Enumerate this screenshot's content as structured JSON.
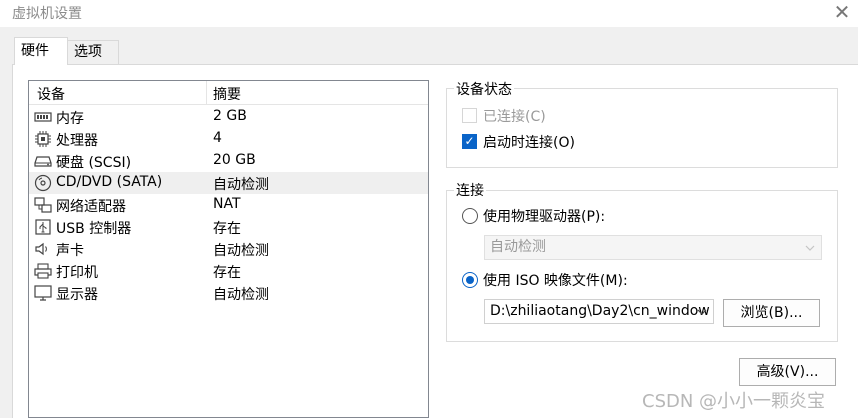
{
  "window": {
    "title": "虚拟机设置",
    "close_glyph": "✕"
  },
  "tabs": [
    {
      "label": "硬件"
    },
    {
      "label": "选项"
    }
  ],
  "device_list": {
    "headers": {
      "device": "设备",
      "summary": "摘要"
    },
    "rows": [
      {
        "name": "内存",
        "summary": "2 GB",
        "icon": "memory-icon"
      },
      {
        "name": "处理器",
        "summary": "4",
        "icon": "cpu-icon"
      },
      {
        "name": "硬盘 (SCSI)",
        "summary": "20 GB",
        "icon": "hard-disk-icon"
      },
      {
        "name": "CD/DVD (SATA)",
        "summary": "自动检测",
        "icon": "cd-dvd-icon"
      },
      {
        "name": "网络适配器",
        "summary": "NAT",
        "icon": "network-adapter-icon"
      },
      {
        "name": "USB 控制器",
        "summary": "存在",
        "icon": "usb-icon"
      },
      {
        "name": "声卡",
        "summary": "自动检测",
        "icon": "speaker-icon"
      },
      {
        "name": "打印机",
        "summary": "存在",
        "icon": "printer-icon"
      },
      {
        "name": "显示器",
        "summary": "自动检测",
        "icon": "monitor-icon"
      }
    ],
    "selected_index": 3
  },
  "device_status": {
    "title": "设备状态",
    "connected_label": "已连接(C)",
    "connect_on_power_on_label": "启动时连接(O)"
  },
  "connection": {
    "title": "连接",
    "physical_drive_label": "使用物理驱动器(P):",
    "physical_drive_value": "自动检测",
    "iso_label": "使用 ISO 映像文件(M):",
    "iso_path": "D:\\zhiliaotang\\Day2\\cn_window",
    "browse_label": "浏览(B)..."
  },
  "advanced_label": "高级(V)...",
  "watermark": "CSDN @小小一颗炎宝",
  "colors": {
    "accent": "#0a64c8",
    "selected_row": "#efefef",
    "disabled_text": "#9a9a9a"
  }
}
